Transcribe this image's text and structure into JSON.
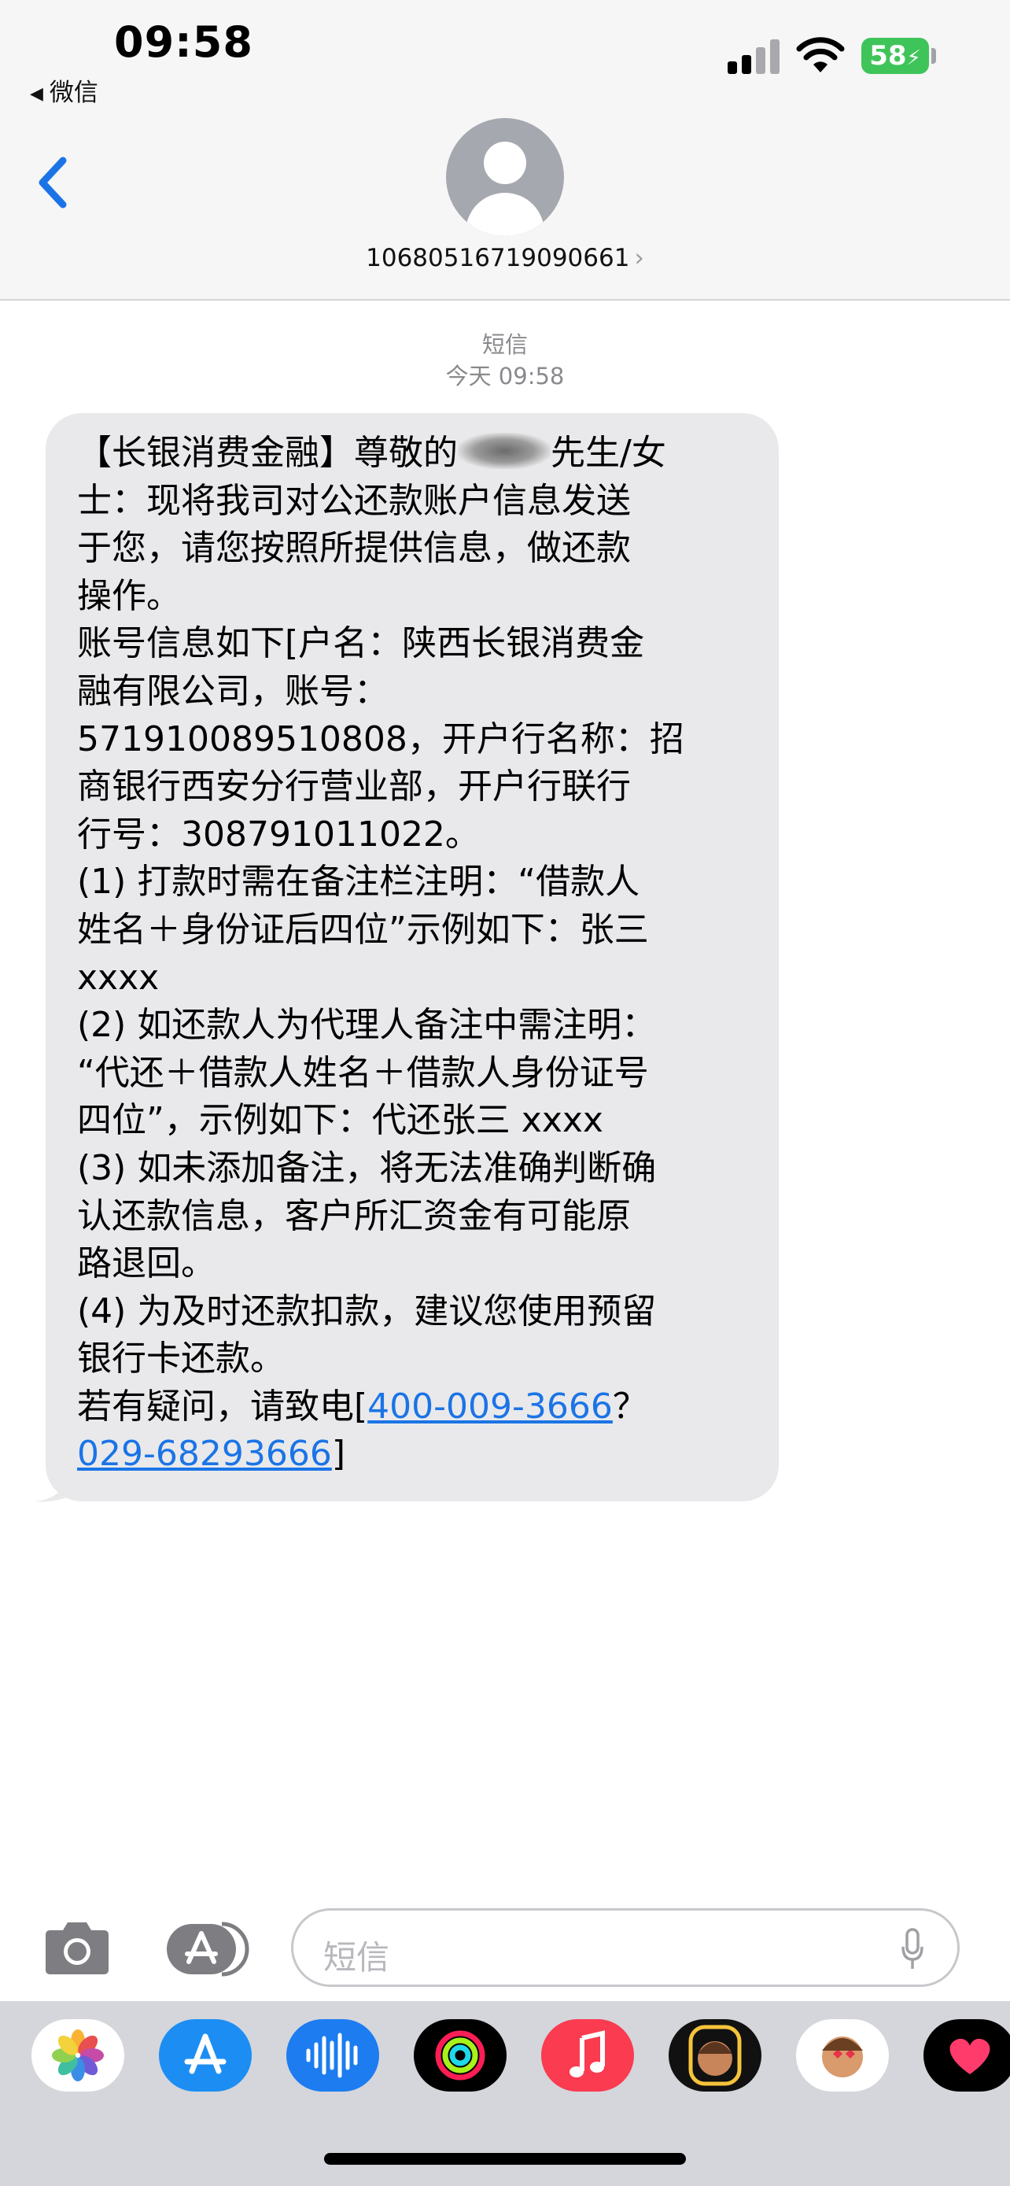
{
  "status_bar": {
    "time": "09:58",
    "back_app": "微信",
    "battery": "58"
  },
  "header": {
    "contact": "10680516719090661",
    "chevron": "›"
  },
  "thread": {
    "service": "短信",
    "timestamp": "今天 09:58"
  },
  "message": {
    "lines": [
      "【长银消费金融】尊敬的",
      "士：现将我司对公还款账户信息发送",
      "于您，请您按照所提供信息，做还款",
      "操作。",
      "账号信息如下[户名：陕西长银消费金",
      "融有限公司，账号：",
      "571910089510808，开户行名称：招",
      "商银行西安分行营业部，开户行联行",
      "行号：308791011022。",
      "(1) 打款时需在备注栏注明：“借款人",
      "姓名＋身份证后四位”示例如下：张三",
      "xxxx",
      "(2) 如还款人为代理人备注中需注明：",
      "“代还＋借款人姓名＋借款人身份证号",
      "四位”，示例如下：代还张三 xxxx",
      "(3) 如未添加备注，将无法准确判断确",
      "认还款信息，客户所汇资金有可能原",
      "路退回。",
      "(4) 为及时还款扣款，建议您使用预留",
      "银行卡还款。",
      "若有疑问，请致电["
    ],
    "line1_suffix": "先生/女",
    "phone1": "400-009-3666",
    "separator": "？",
    "phone2": "029-68293666",
    "closing": "]"
  },
  "composer": {
    "placeholder": "短信"
  },
  "app_tray": [
    {
      "icon": "photos-icon",
      "color": "#ffffff"
    },
    {
      "icon": "app-store-icon",
      "color": "#1c8ef3"
    },
    {
      "icon": "audio-message-icon",
      "color": "#1c7cf0"
    },
    {
      "icon": "activity-icon",
      "color": "#000000"
    },
    {
      "icon": "music-icon",
      "color": "#fa3b50"
    },
    {
      "icon": "memoji-icon",
      "color": "#111111"
    },
    {
      "icon": "memoji-stickers-icon",
      "color": "#ffffff"
    },
    {
      "icon": "digital-touch-icon",
      "color": "#000000"
    }
  ],
  "colors": {
    "accent": "#1b74e6",
    "bubble": "#e9e9eb",
    "battery": "#3fc45a"
  }
}
